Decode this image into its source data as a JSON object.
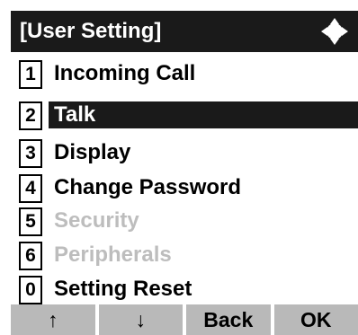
{
  "header": {
    "title": "[User Setting]",
    "nav_icon": "four-way-navigation-icon"
  },
  "menu": {
    "items": [
      {
        "number": "1",
        "label": "Incoming Call",
        "state": "normal"
      },
      {
        "number": "2",
        "label": "Talk",
        "state": "selected"
      },
      {
        "number": "3",
        "label": "Display",
        "state": "normal"
      },
      {
        "number": "4",
        "label": "Change Password",
        "state": "normal"
      },
      {
        "number": "5",
        "label": "Security",
        "state": "disabled"
      },
      {
        "number": "6",
        "label": "Peripherals",
        "state": "disabled"
      },
      {
        "number": "0",
        "label": "Setting Reset",
        "state": "normal"
      }
    ]
  },
  "softkeys": {
    "up": "↑",
    "down": "↓",
    "back": "Back",
    "ok": "OK"
  },
  "colors": {
    "title_bar": "#1a1a1a",
    "selected_row": "#1a1a1a",
    "disabled_text": "#bdbdbd",
    "softkey_bg": "#b9b9b9"
  }
}
